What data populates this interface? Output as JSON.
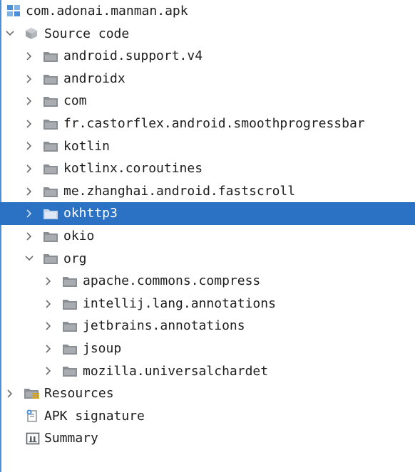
{
  "tree": {
    "root": {
      "label": "com.adonai.manman.apk",
      "icon": "apk-icon"
    },
    "source": {
      "label": "Source code",
      "icon": "package-cube-icon",
      "expanded": true
    },
    "packages": [
      {
        "label": "android.support.v4"
      },
      {
        "label": "androidx"
      },
      {
        "label": "com"
      },
      {
        "label": "fr.castorflex.android.smoothprogressbar"
      },
      {
        "label": "kotlin"
      },
      {
        "label": "kotlinx.coroutines"
      },
      {
        "label": "me.zhanghai.android.fastscroll"
      },
      {
        "label": "okhttp3",
        "selected": true
      },
      {
        "label": "okio"
      },
      {
        "label": "org",
        "expanded": true
      }
    ],
    "org_children": [
      {
        "label": "apache.commons.compress"
      },
      {
        "label": "intellij.lang.annotations"
      },
      {
        "label": "jetbrains.annotations"
      },
      {
        "label": "jsoup"
      },
      {
        "label": "mozilla.universalchardet"
      }
    ],
    "resources": {
      "label": "Resources"
    },
    "apk_signature": {
      "label": "APK signature"
    },
    "summary": {
      "label": "Summary"
    }
  },
  "colors": {
    "selection": "#2b72c4",
    "folder": "#8a8f94",
    "chevron": "#6e6e6e",
    "apk_icon": "#4a90d9"
  }
}
